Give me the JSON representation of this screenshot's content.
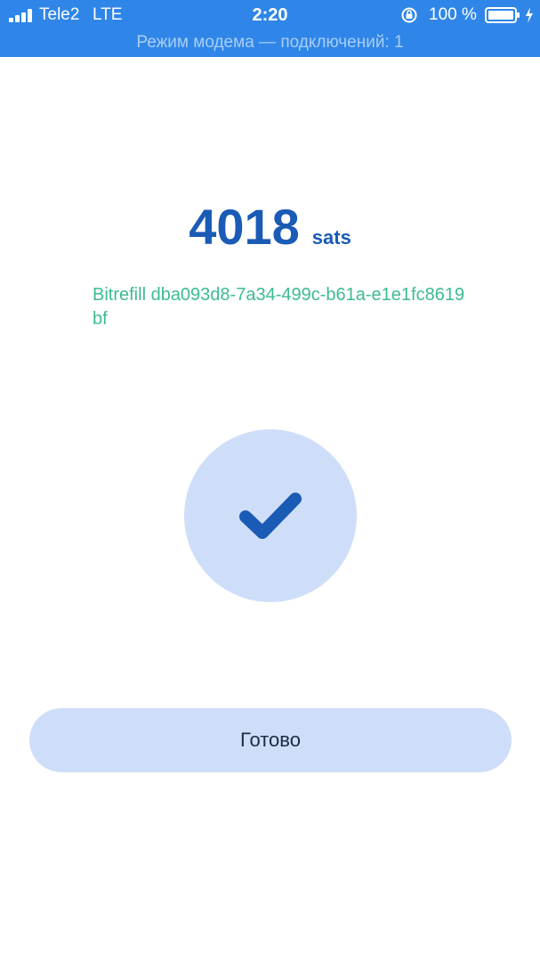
{
  "status_bar": {
    "carrier": "Tele2",
    "network": "LTE",
    "time": "2:20",
    "battery_percent": "100 %",
    "hotspot_banner": "Режим модема — подключений: 1",
    "icons": [
      "signal-bars-icon",
      "rotation-lock-icon",
      "battery-icon",
      "charging-bolt-icon"
    ],
    "background_color": "#2f86e8"
  },
  "payment": {
    "amount": "4018",
    "unit": "sats",
    "memo": "Bitrefill dba093d8-7a34-499c-b61a-e1e1fc8619bf",
    "amount_color": "#1a5bb5",
    "memo_color": "#3dbb92"
  },
  "success": {
    "icon": "checkmark-icon",
    "circle_color": "#cfdef8"
  },
  "actions": {
    "done_label": "Готово"
  }
}
